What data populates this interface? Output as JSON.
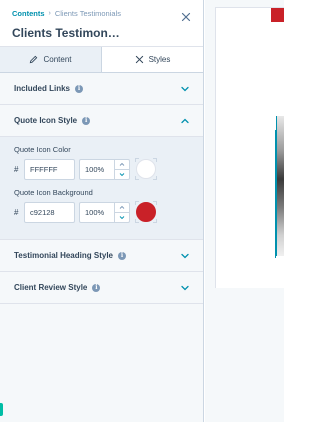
{
  "header": {
    "breadcrumb_root": "Contents",
    "breadcrumb_current": "Clients Testimonials",
    "title": "Clients Testimon…"
  },
  "tabs": [
    {
      "label": "Content",
      "icon": "pencil-icon",
      "active": false
    },
    {
      "label": "Styles",
      "icon": "brush-icon",
      "active": true
    }
  ],
  "sections": {
    "included_links": {
      "label": "Included Links",
      "expanded": false
    },
    "quote_icon_style": {
      "label": "Quote Icon Style",
      "expanded": true,
      "fields": {
        "icon_color": {
          "label": "Quote Icon Color",
          "hex": "FFFFFF",
          "opacity": "100%",
          "swatch": "#ffffff"
        },
        "icon_background": {
          "label": "Quote Icon Background",
          "hex": "c92128",
          "opacity": "100%",
          "swatch": "#c92128"
        }
      }
    },
    "testimonial_heading_style": {
      "label": "Testimonial Heading Style",
      "expanded": false
    },
    "client_review_style": {
      "label": "Client Review Style",
      "expanded": false
    }
  },
  "colors": {
    "accent": "#0091ae",
    "text": "#33475b",
    "brand_red": "#c92128"
  }
}
